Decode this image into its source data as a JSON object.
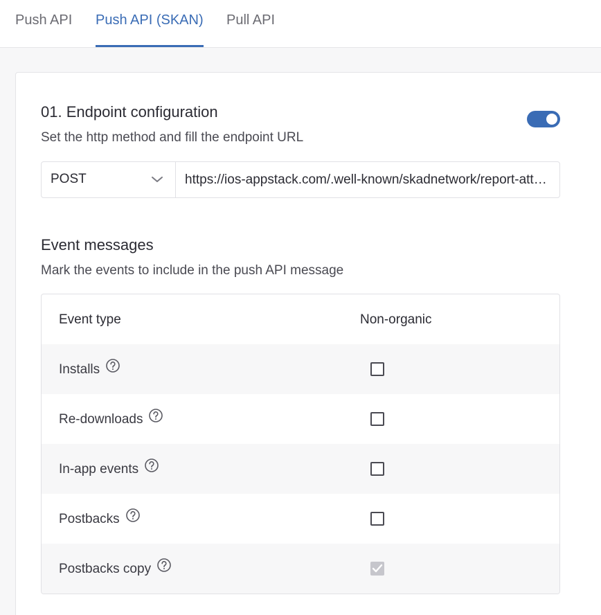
{
  "tabs": [
    {
      "label": "Push API",
      "active": false
    },
    {
      "label": "Push API (SKAN)",
      "active": true
    },
    {
      "label": "Pull API",
      "active": false
    }
  ],
  "endpoint": {
    "title": "01. Endpoint configuration",
    "subtitle": "Set the http method and fill the endpoint URL",
    "toggle_on": true,
    "method": "POST",
    "url": "https://ios-appstack.com/.well-known/skadnetwork/report-attribution/"
  },
  "events": {
    "title": "Event messages",
    "subtitle": "Mark the events to include in the push API message",
    "columns": [
      "Event type",
      "Non-organic"
    ],
    "rows": [
      {
        "label": "Installs",
        "checked": false,
        "disabled": false
      },
      {
        "label": "Re-downloads",
        "checked": false,
        "disabled": false
      },
      {
        "label": "In-app events",
        "checked": false,
        "disabled": false
      },
      {
        "label": "Postbacks",
        "checked": false,
        "disabled": false
      },
      {
        "label": "Postbacks copy",
        "checked": true,
        "disabled": true
      }
    ]
  },
  "icons": {
    "help": "question-circle-icon",
    "dropdown": "chevron-down-icon",
    "check": "check-icon"
  },
  "colors": {
    "accent": "#3a6cb5",
    "disabled_check": "#c6c6cc"
  }
}
